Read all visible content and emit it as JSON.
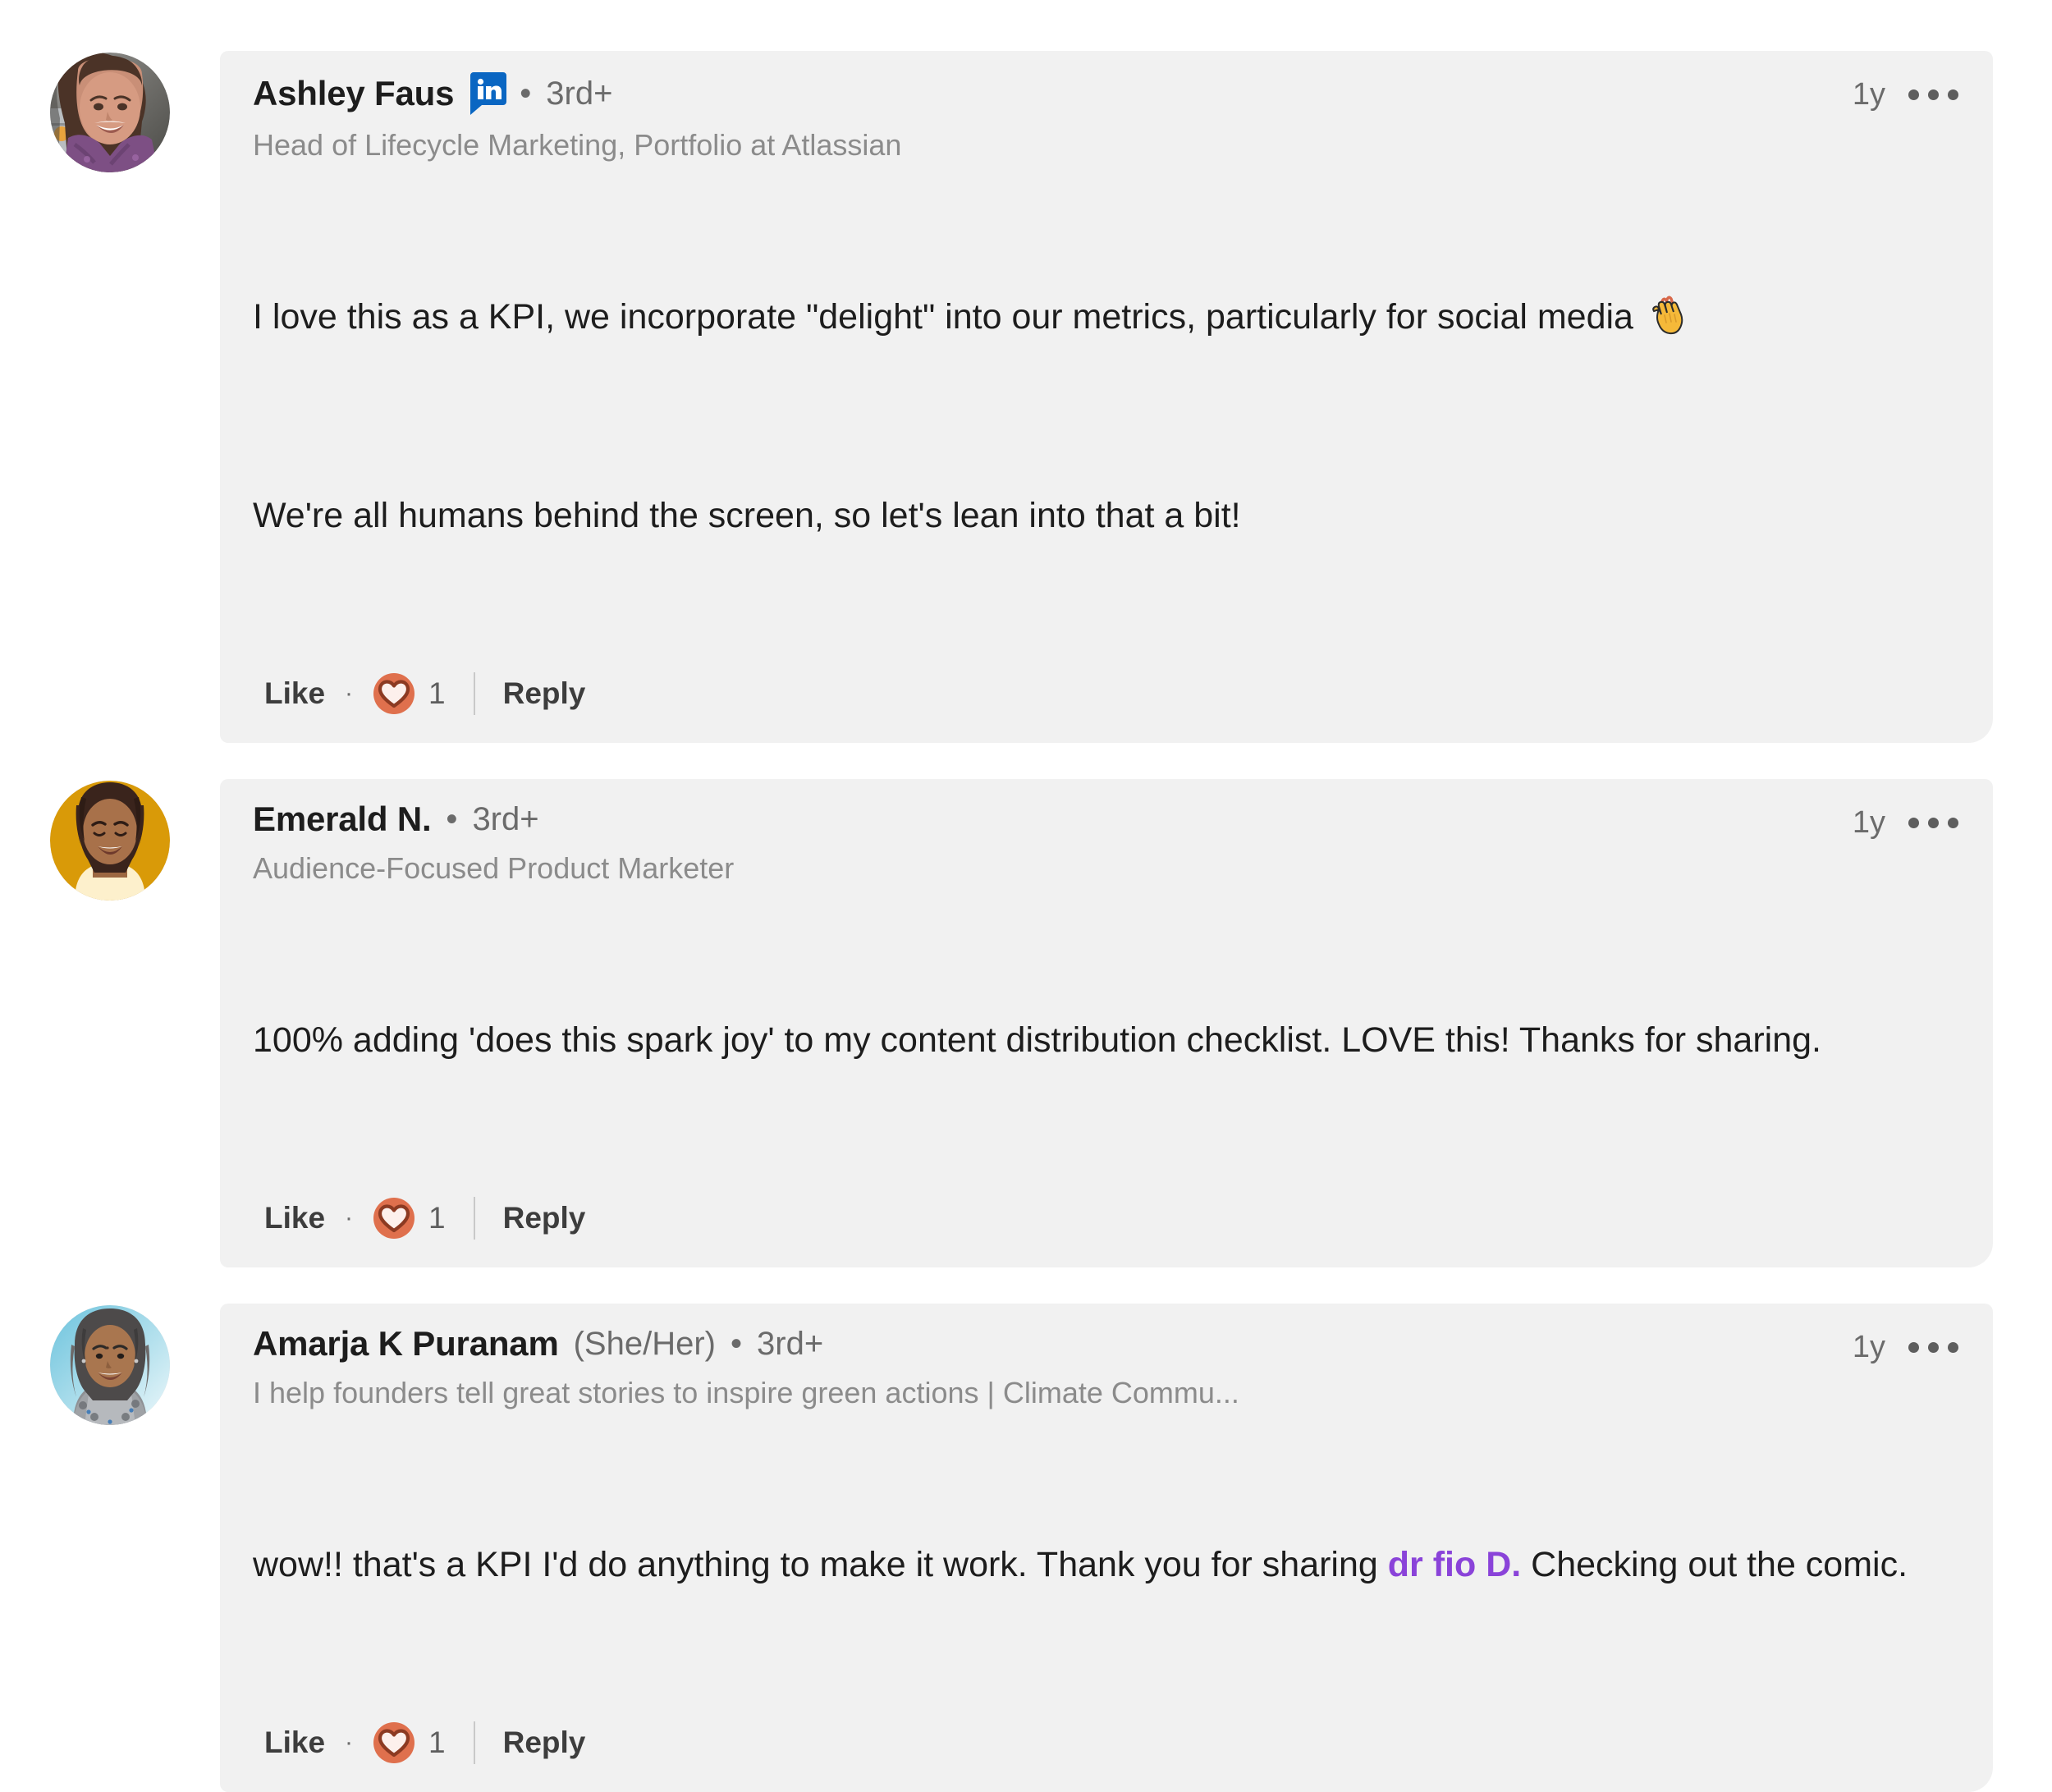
{
  "theme": {
    "page_bg": "#ffffff",
    "bubble_bg": "#f1f1f1",
    "text_primary": "#1d1d1d",
    "text_secondary": "#6b6b6b",
    "text_muted": "#8b8b8b",
    "mention_purple": "#8a43d9",
    "linkedin_blue": "#0a66c2",
    "reaction_love_bg": "#df704d",
    "reaction_love_stroke": "#8c3a22",
    "reaction_love_fill": "#fdf0ec"
  },
  "labels": {
    "like": "Like",
    "reply": "Reply",
    "separator_dot": "·",
    "middot": "•",
    "more_options": "More options"
  },
  "icons": {
    "linkedin_badge": "linkedin-verified-badge-icon",
    "more": "ellipsis-icon",
    "reaction": "love-reaction-icon",
    "emoji": "clapping-hands-emoji"
  },
  "comments": [
    {
      "id": "comment-1",
      "author": "Ashley Faus",
      "pronouns": "",
      "has_linkedin_badge": true,
      "degree": "3rd+",
      "headline": "Head of Lifecycle Marketing, Portfolio at Atlassian",
      "timestamp": "1y",
      "paragraphs": [
        {
          "segments": [
            {
              "type": "text",
              "text": "I love this as a KPI, we incorporate \"delight\" into our metrics, particularly for social media "
            },
            {
              "type": "emoji",
              "name": "clapping-hands-emoji"
            }
          ]
        },
        {
          "segments": [
            {
              "type": "text",
              "text": "We're all humans behind the screen, so let's lean into that a bit!"
            }
          ]
        }
      ],
      "reaction_count": "1",
      "avatar": "photo-woman-curly-brown-hair-purple-scarf"
    },
    {
      "id": "comment-2",
      "author": "Emerald N.",
      "pronouns": "",
      "has_linkedin_badge": false,
      "degree": "3rd+",
      "headline": "Audience-Focused Product Marketer",
      "timestamp": "1y",
      "paragraphs": [
        {
          "segments": [
            {
              "type": "text",
              "text": "100% adding 'does this spark joy' to my content distribution checklist. LOVE this! Thanks for sharing."
            }
          ]
        }
      ],
      "reaction_count": "1",
      "avatar": "illustrated-avatar-gold-background-dark-hair-cream-shirt"
    },
    {
      "id": "comment-3",
      "author": "Amarja K Puranam",
      "pronouns": "(She/Her)",
      "has_linkedin_badge": false,
      "degree": "3rd+",
      "headline": "I help founders tell great stories to inspire green actions | Climate Commu...",
      "timestamp": "1y",
      "paragraphs": [
        {
          "segments": [
            {
              "type": "text",
              "text": "wow!! that's a KPI I'd do anything to make it work. Thank you for sharing "
            },
            {
              "type": "mention",
              "text": "dr fio D."
            },
            {
              "type": "text",
              "text": " Checking out the comic."
            }
          ]
        }
      ],
      "reaction_count": "1",
      "avatar": "photo-woman-blue-background-grey-patterned-top"
    }
  ]
}
